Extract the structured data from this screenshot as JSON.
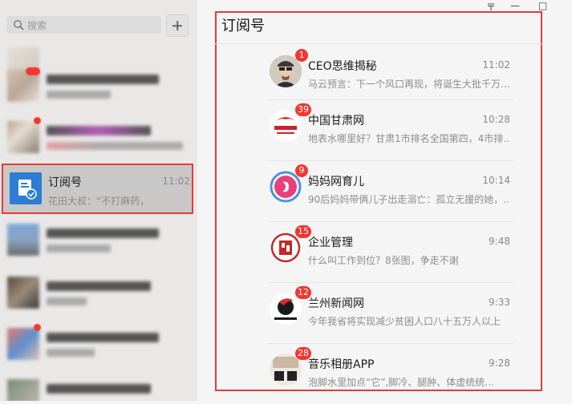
{
  "search": {
    "placeholder": "搜索",
    "add_icon": "plus-icon"
  },
  "selected_chat": {
    "name": "订阅号",
    "time": "11:02",
    "preview": "花田大叔：“不打麻药，",
    "icon": "subscription-icon",
    "color": "#2e7cd4"
  },
  "window_controls": {
    "pin": "〒",
    "minimize": "—",
    "maximize": "□"
  },
  "main": {
    "title": "订阅号",
    "subscriptions": [
      {
        "name": "CEO思维揭秘",
        "time": "11:02",
        "preview": "马云预言：下一个风口再现，将诞生大批千万...",
        "badge": "1",
        "avatar": "ceo-avatar-icon"
      },
      {
        "name": "中国甘肃网",
        "time": "10:28",
        "preview": "地表水哪里好？甘肃1市排名全国第四，4市排...",
        "badge": "39",
        "avatar": "gansu-logo-icon"
      },
      {
        "name": "妈妈网育儿",
        "time": "10:14",
        "preview": "90后妈妈带俩儿子出走溺亡：孤立无援的她，...",
        "badge": "9",
        "avatar": "mama-logo-icon"
      },
      {
        "name": "企业管理",
        "time": "9:48",
        "preview": "什么叫工作到位？8张图，争走不谢",
        "badge": "15",
        "avatar": "management-logo-icon"
      },
      {
        "name": "兰州新闻网",
        "time": "9:33",
        "preview": "今年我省将实现减少贫困人口八十五万人以上",
        "badge": "12",
        "avatar": "lanzhou-logo-icon"
      },
      {
        "name": "音乐相册APP",
        "time": "9:28",
        "preview": "泡脚水里加点“它”,脚冷、腿肿、体虚统统...",
        "badge": "28",
        "avatar": "album-logo-icon"
      }
    ]
  }
}
